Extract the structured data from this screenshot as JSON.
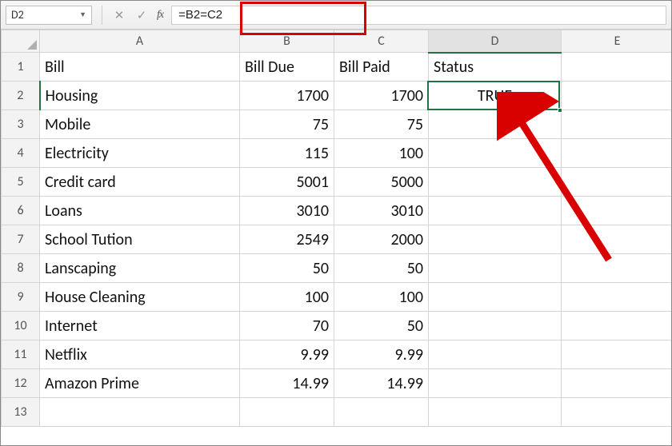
{
  "name_box": {
    "value": "D2"
  },
  "formula_bar": {
    "value": "=B2=C2"
  },
  "column_headers": [
    "A",
    "B",
    "C",
    "D",
    "E"
  ],
  "row_headers": [
    "1",
    "2",
    "3",
    "4",
    "5",
    "6",
    "7",
    "8",
    "9",
    "10",
    "11",
    "12",
    "13"
  ],
  "grid": {
    "header_row": {
      "A": "Bill",
      "B": "Bill Due",
      "C": "Bill Paid",
      "D": "Status"
    },
    "rows": [
      {
        "A": "Housing",
        "B": "1700",
        "C": "1700",
        "D": "TRUE"
      },
      {
        "A": "Mobile",
        "B": "75",
        "C": "75",
        "D": ""
      },
      {
        "A": "Electricity",
        "B": "115",
        "C": "100",
        "D": ""
      },
      {
        "A": "Credit card",
        "B": "5001",
        "C": "5000",
        "D": ""
      },
      {
        "A": "Loans",
        "B": "3010",
        "C": "3010",
        "D": ""
      },
      {
        "A": "School Tution",
        "B": "2549",
        "C": "2000",
        "D": ""
      },
      {
        "A": "Lanscaping",
        "B": "50",
        "C": "50",
        "D": ""
      },
      {
        "A": "House Cleaning",
        "B": "100",
        "C": "100",
        "D": ""
      },
      {
        "A": "Internet",
        "B": "70",
        "C": "50",
        "D": ""
      },
      {
        "A": "Netflix",
        "B": "9.99",
        "C": "9.99",
        "D": ""
      },
      {
        "A": "Amazon Prime",
        "B": "14.99",
        "C": "14.99",
        "D": ""
      }
    ]
  },
  "active_cell": "D2",
  "colors": {
    "excel_green": "#217346",
    "callout_red": "#d90000"
  }
}
